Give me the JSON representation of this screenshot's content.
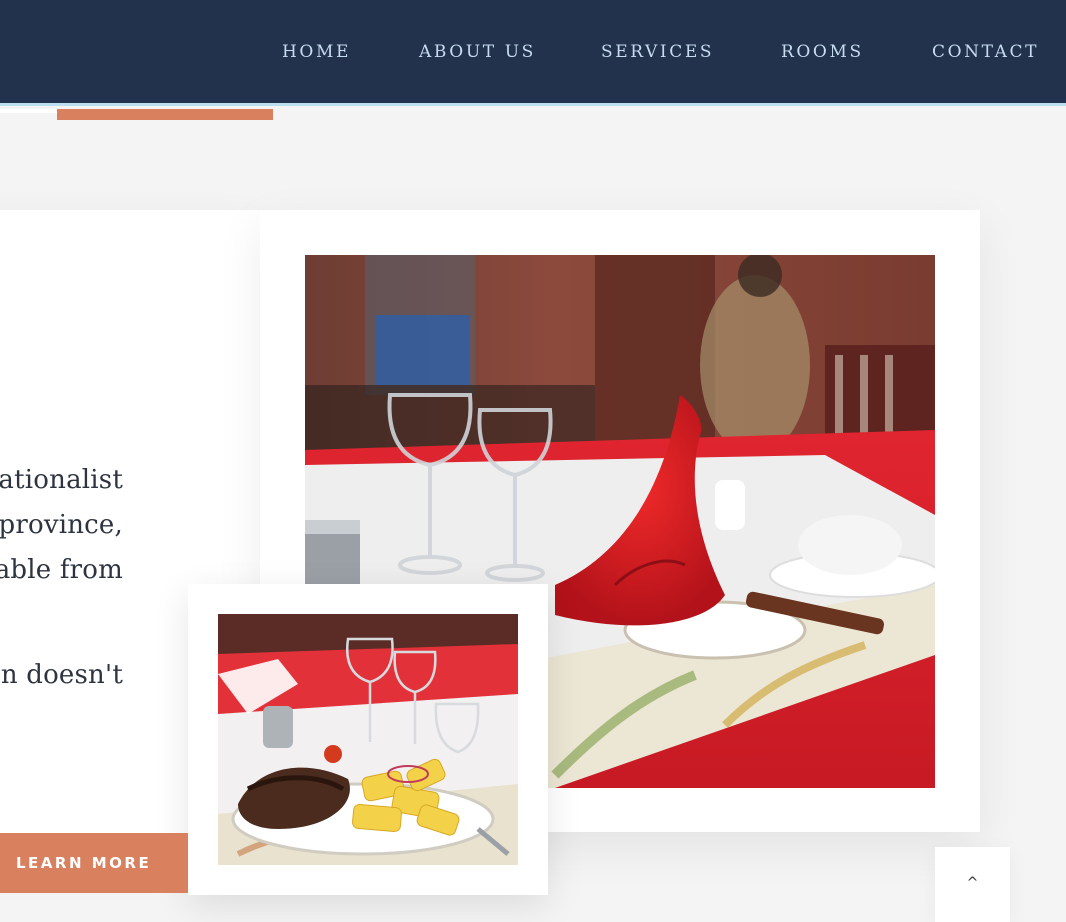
{
  "nav": {
    "items": [
      {
        "label": "HOME"
      },
      {
        "label": "ABOUT US"
      },
      {
        "label": "SERVICES"
      },
      {
        "label": "ROOMS"
      },
      {
        "label": "CONTACT"
      }
    ]
  },
  "about": {
    "lines": [
      "nationalist",
      "province,",
      "able  from",
      "en doesn't"
    ],
    "cta_label": "LEARN MORE"
  },
  "scroll_top": {
    "icon": "chevron-up-icon",
    "glyph": "^"
  },
  "colors": {
    "navbar_bg": "#22314c",
    "nav_text": "#c6dcef",
    "accent": "#d9805f",
    "card_bg": "#ffffff",
    "page_bg": "#f4f4f4"
  }
}
